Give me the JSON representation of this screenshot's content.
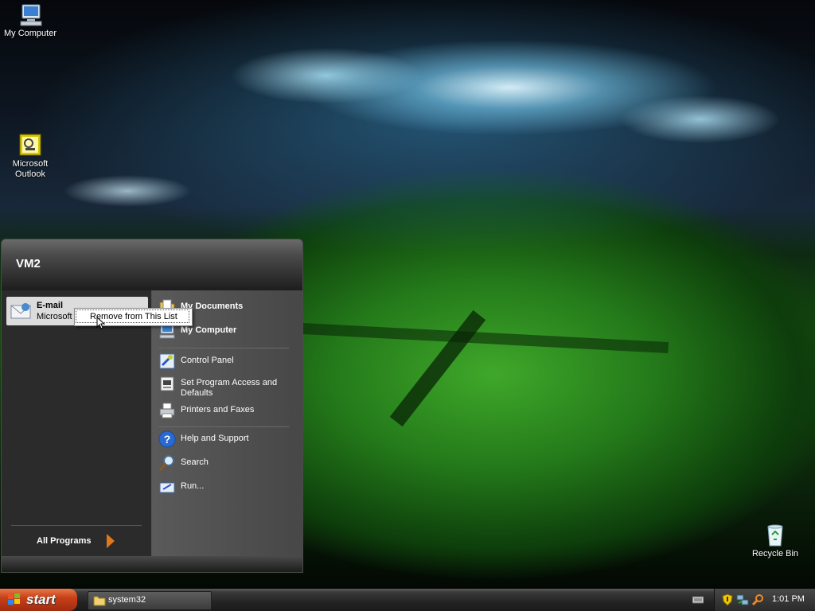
{
  "desktop": {
    "icons": [
      {
        "label": "My Computer",
        "icon": "my-computer-icon"
      },
      {
        "label": "Microsoft\nOutlook",
        "icon": "outlook-icon"
      },
      {
        "label": "Recycle Bin",
        "icon": "recycle-bin-icon"
      }
    ]
  },
  "start_menu": {
    "user": "VM2",
    "pinned": {
      "title": "E-mail",
      "subtitle": "Microsoft"
    },
    "context_menu": {
      "item": "Remove from This List"
    },
    "all_programs": "All Programs",
    "right_items": [
      {
        "label": "My Documents",
        "bold": true,
        "icon": "my-documents-icon"
      },
      {
        "label": "My Computer",
        "bold": true,
        "icon": "my-computer-icon"
      },
      {
        "label": "Control Panel",
        "bold": false,
        "icon": "control-panel-icon"
      },
      {
        "label": "Set Program Access and Defaults",
        "bold": false,
        "icon": "program-access-icon"
      },
      {
        "label": "Printers and Faxes",
        "bold": false,
        "icon": "printer-icon"
      },
      {
        "label": "Help and Support",
        "bold": false,
        "icon": "help-icon"
      },
      {
        "label": "Search",
        "bold": false,
        "icon": "search-icon"
      },
      {
        "label": "Run...",
        "bold": false,
        "icon": "run-icon"
      }
    ]
  },
  "taskbar": {
    "start_label": "start",
    "task": "system32",
    "clock": "1:01 PM"
  }
}
